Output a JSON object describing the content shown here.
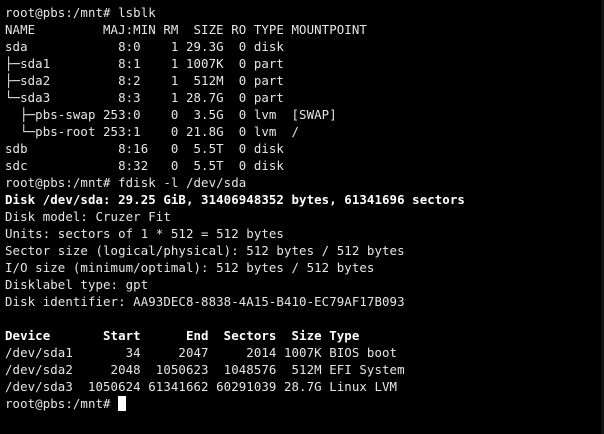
{
  "colors": {
    "background": "#000000",
    "text": "#e6e6e6",
    "bold_text": "#ffffff",
    "cursor": "#ffffff"
  },
  "terminal": {
    "lines": [
      {
        "text": "root@pbs:/mnt# lsblk",
        "bold": false
      },
      {
        "text": "NAME         MAJ:MIN RM  SIZE RO TYPE MOUNTPOINT",
        "bold": false
      },
      {
        "text": "sda            8:0    1 29.3G  0 disk",
        "bold": false
      },
      {
        "text": "├─sda1         8:1    1 1007K  0 part",
        "bold": false
      },
      {
        "text": "├─sda2         8:2    1  512M  0 part",
        "bold": false
      },
      {
        "text": "└─sda3         8:3    1 28.7G  0 part",
        "bold": false
      },
      {
        "text": "  ├─pbs-swap 253:0    0  3.5G  0 lvm  [SWAP]",
        "bold": false
      },
      {
        "text": "  └─pbs-root 253:1    0 21.8G  0 lvm  /",
        "bold": false
      },
      {
        "text": "sdb            8:16   0  5.5T  0 disk",
        "bold": false
      },
      {
        "text": "sdc            8:32   0  5.5T  0 disk",
        "bold": false
      },
      {
        "text": "root@pbs:/mnt# fdisk -l /dev/sda",
        "bold": false
      },
      {
        "text": "Disk /dev/sda: 29.25 GiB, 31406948352 bytes, 61341696 sectors",
        "bold": true
      },
      {
        "text": "Disk model: Cruzer Fit",
        "bold": false
      },
      {
        "text": "Units: sectors of 1 * 512 = 512 bytes",
        "bold": false
      },
      {
        "text": "Sector size (logical/physical): 512 bytes / 512 bytes",
        "bold": false
      },
      {
        "text": "I/O size (minimum/optimal): 512 bytes / 512 bytes",
        "bold": false
      },
      {
        "text": "Disklabel type: gpt",
        "bold": false
      },
      {
        "text": "Disk identifier: AA93DEC8-8838-4A15-B410-EC79AF17B093",
        "bold": false
      },
      {
        "text": "",
        "bold": false
      },
      {
        "text": "Device       Start      End  Sectors  Size Type",
        "bold": true
      },
      {
        "text": "/dev/sda1       34     2047     2014 1007K BIOS boot",
        "bold": false
      },
      {
        "text": "/dev/sda2     2048  1050623  1048576  512M EFI System",
        "bold": false
      },
      {
        "text": "/dev/sda3  1050624 61341662 60291039 28.7G Linux LVM",
        "bold": false
      }
    ],
    "prompt": "root@pbs:/mnt# "
  }
}
